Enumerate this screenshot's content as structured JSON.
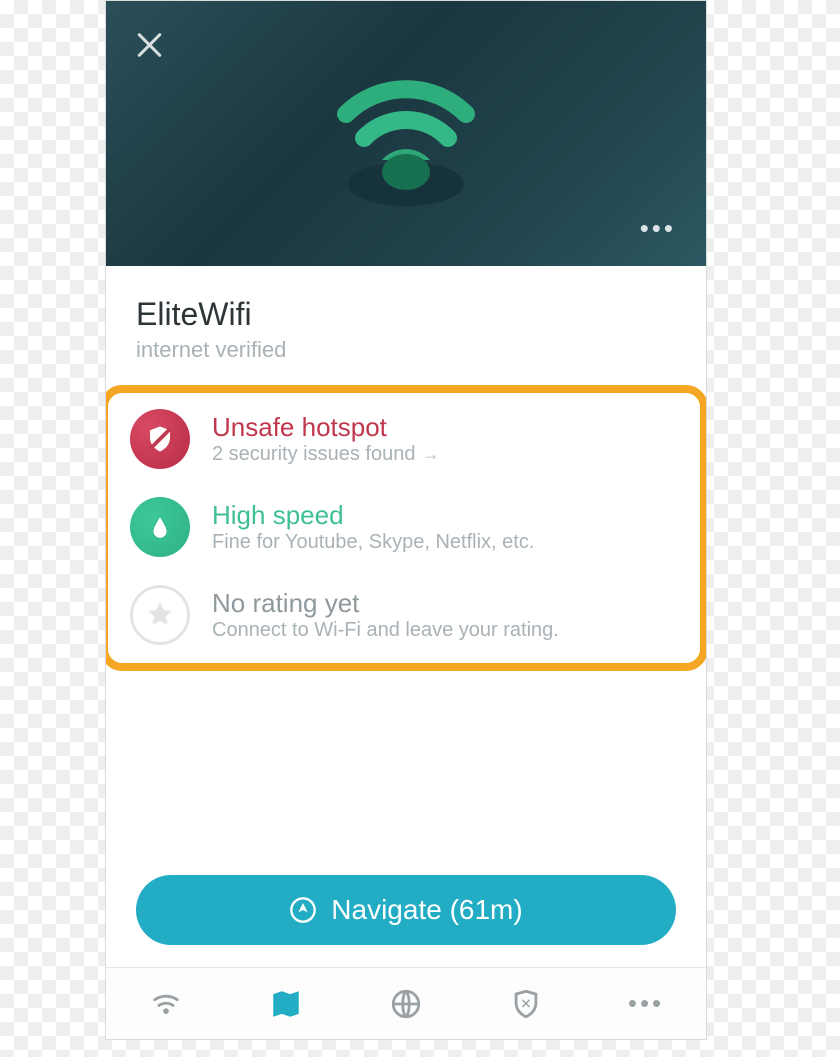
{
  "colors": {
    "accent": "#23adc5",
    "highlight_border": "#f5a623",
    "danger": "#c0374d",
    "success": "#3fbf94"
  },
  "hero": {
    "close_icon": "close-icon",
    "more_icon": "more-icon"
  },
  "network": {
    "name": "EliteWifi",
    "status": "internet verified"
  },
  "rows": [
    {
      "icon": "shield-slash-icon",
      "title": "Unsafe hotspot",
      "subtitle": "2 security issues found",
      "has_arrow": true,
      "tone": "danger"
    },
    {
      "icon": "drop-icon",
      "title": "High speed",
      "subtitle": "Fine for Youtube, Skype, Netflix, etc.",
      "has_arrow": false,
      "tone": "success"
    },
    {
      "icon": "star-icon",
      "title": "No rating yet",
      "subtitle": "Connect to Wi-Fi and leave your rating.",
      "has_arrow": false,
      "tone": "neutral"
    }
  ],
  "navigate": {
    "label": "Navigate (61m)"
  },
  "tabbar": {
    "items": [
      "wifi-icon",
      "map-icon",
      "globe-icon",
      "shield-icon",
      "more-icon"
    ],
    "active_index": 1
  }
}
